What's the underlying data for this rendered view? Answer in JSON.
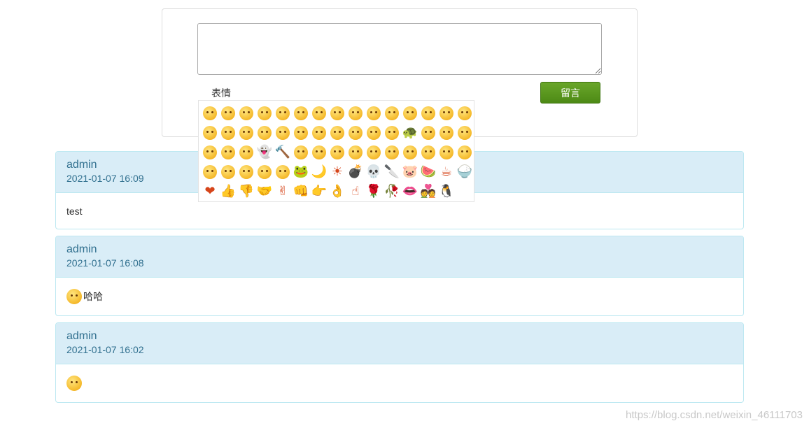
{
  "form": {
    "textarea_value": "",
    "emoji_toggle_label": "表情",
    "submit_label": "留言"
  },
  "emoji_panel": {
    "rows": 5,
    "columns": 15,
    "count": 75,
    "icons": [
      "smile",
      "grimace",
      "heart-eyes",
      "smirk",
      "crying",
      "surprised",
      "dizzy",
      "sleepy",
      "angry-red",
      "angry-pout",
      "cool-frame",
      "grin",
      "big-grin",
      "shy",
      "sad",
      "blush",
      "laugh-tears",
      "nervous",
      "think",
      "grimace-2",
      "shock",
      "puzzled",
      "stare",
      "zipped",
      "rage",
      "tongue",
      "turtle",
      "smug",
      "frown",
      "spiral-eyes",
      "scream",
      "dizzy-2",
      "sob",
      "black-ghost",
      "hammer",
      "ponder",
      "yawn",
      "wink",
      "cheeky",
      "pinch",
      "plead",
      "annoyed",
      "grumpy",
      "hug",
      "sick",
      "meh",
      "kiss",
      "whistle",
      "panic",
      "cover-face",
      "frog",
      "moon",
      "sun",
      "bomb",
      "skull",
      "knife",
      "pig",
      "watermelon",
      "coffee",
      "rice",
      "heart",
      "thumbs-up",
      "thumbs-down",
      "handshake",
      "victory",
      "fist",
      "point",
      "ok-hand",
      "finger-point",
      "rose",
      "wilted-rose",
      "lips",
      "love-couple",
      "penguin"
    ]
  },
  "messages": [
    {
      "author": "admin",
      "time": "2021-01-07 16:09",
      "body_text": "test",
      "body_emoji": ""
    },
    {
      "author": "admin",
      "time": "2021-01-07 16:08",
      "body_text": "哈哈",
      "body_emoji": "grimace-icon"
    },
    {
      "author": "admin",
      "time": "2021-01-07 16:02",
      "body_text": "",
      "body_emoji": "smirk-icon"
    }
  ],
  "watermark": "https://blog.csdn.net/weixin_46111703",
  "colors": {
    "panel_heading_bg": "#d9edf7",
    "panel_border": "#bce8f1",
    "heading_text": "#31708f",
    "submit_green": "#5a9a1e"
  }
}
